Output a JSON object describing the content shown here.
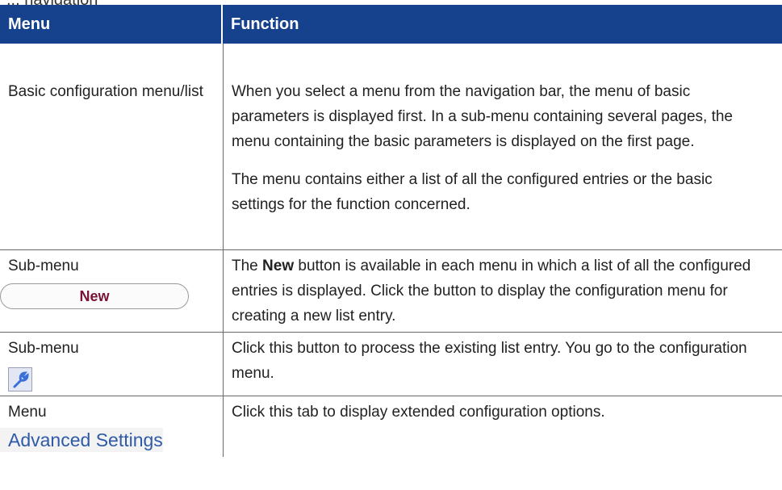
{
  "caption": "... navigation",
  "table": {
    "headers": {
      "menu": "Menu",
      "function": "Function"
    },
    "rows": [
      {
        "menu": "Basic configuration menu/list",
        "function_p1": "When you select a menu from the navigation bar, the menu of basic parameters is displayed first. In a sub-menu containing several pages, the menu containing the basic parameters is displayed on the first page.",
        "function_p2": "The menu contains either a list of all the configured entries or the basic settings for the function concerned."
      },
      {
        "menu": "Sub-menu",
        "button_label": "New",
        "function_pre": "The ",
        "function_bold": "New",
        "function_post": " button is available in each menu in which a list of all the configured entries is displayed. Click the button to display the configuration menu for creating a new list entry."
      },
      {
        "menu": "Sub-menu",
        "icon": "wrench-icon",
        "function": "Click this button to process the existing list entry. You go to the configuration menu."
      },
      {
        "menu": "Menu",
        "tab_label": "Advanced Settings",
        "function": "Click this tab to display extended configuration options."
      }
    ]
  },
  "colors": {
    "header_bg": "#16418c",
    "header_text": "#ffffff",
    "button_text": "#7a1238",
    "tab_text": "#2f5aa8"
  }
}
